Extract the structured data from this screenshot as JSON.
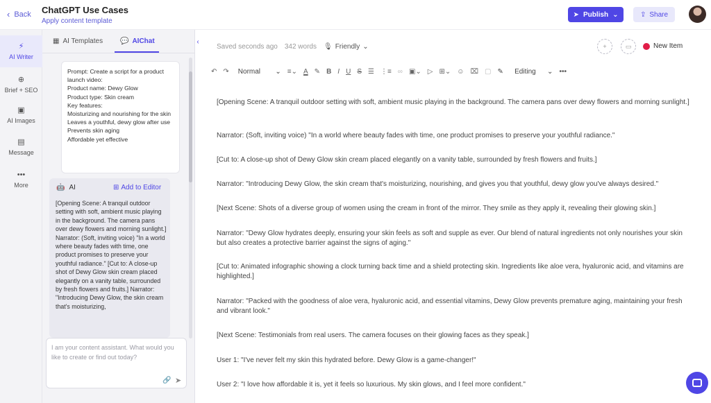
{
  "header": {
    "back_label": "Back",
    "title": "ChatGPT Use Cases",
    "subtitle": "Apply content template",
    "publish_label": "Publish",
    "share_label": "Share"
  },
  "rail": {
    "items": [
      {
        "label": "AI Writer",
        "icon": "lightning-icon"
      },
      {
        "label": "Brief + SEO",
        "icon": "target-icon"
      },
      {
        "label": "AI Images",
        "icon": "image-icon"
      },
      {
        "label": "Message",
        "icon": "chat-icon"
      },
      {
        "label": "More",
        "icon": "ellipsis-icon"
      }
    ]
  },
  "panel": {
    "tabs": [
      {
        "label": "AI Templates",
        "icon": "grid-icon"
      },
      {
        "label": "AIChat",
        "icon": "chat-bubbles-icon"
      }
    ],
    "prompt_lines": [
      "Prompt: Create a script for a product launch video:",
      "Product name: Dewy Glow",
      "Product type: Skin cream",
      "Key features:",
      "Moisturizing and nourishing for the skin",
      "Leaves a youthful, dewy glow after use",
      "Prevents skin aging",
      "Affordable yet effective"
    ],
    "ai_label": "AI",
    "add_to_editor": "Add to Editor",
    "ai_text": "[Opening Scene: A tranquil outdoor setting with soft, ambient music playing in the background. The camera pans over dewy flowers and morning sunlight.] Narrator: (Soft, inviting voice) \"In a world where beauty fades with time, one product promises to preserve your youthful radiance.\" [Cut to: A close-up shot of Dewy Glow skin cream placed elegantly on a vanity table, surrounded by fresh flowers and fruits.] Narrator: \"Introducing Dewy Glow, the skin cream that's moisturizing,",
    "input_placeholder": "I am your content assistant. What would you like to create or find out today?"
  },
  "editor": {
    "saved_status": "Saved seconds ago",
    "word_count": "342 words",
    "tone": "Friendly",
    "new_item_label": "New Item",
    "toolbar": {
      "style_select": "Normal",
      "mode_select": "Editing"
    },
    "paragraphs": [
      "[Opening Scene: A tranquil outdoor setting with soft, ambient music playing in the background. The camera pans over dewy flowers and morning sunlight.]",
      "Narrator: (Soft, inviting voice) \"In a world where beauty fades with time, one product promises to preserve your youthful radiance.\"",
      "[Cut to: A close-up shot of Dewy Glow skin cream placed elegantly on a vanity table, surrounded by fresh flowers and fruits.]",
      "Narrator: \"Introducing Dewy Glow, the skin cream that's moisturizing, nourishing, and gives you that youthful, dewy glow you've always desired.\"",
      "[Next Scene: Shots of a diverse group of women using the cream in front of the mirror. They smile as they apply it, revealing their glowing skin.]",
      "Narrator: \"Dewy Glow hydrates deeply, ensuring your skin feels as soft and supple as ever. Our blend of natural ingredients not only nourishes your skin but also creates a protective barrier against the signs of aging.\"",
      "[Cut to: Animated infographic showing a clock turning back time and a shield protecting skin. Ingredients like aloe vera, hyaluronic acid, and vitamins are highlighted.]",
      "Narrator: \"Packed with the goodness of aloe vera, hyaluronic acid, and essential vitamins, Dewy Glow prevents premature aging, maintaining your fresh and vibrant look.\"",
      "[Next Scene: Testimonials from real users. The camera focuses on their glowing faces as they speak.]",
      "User 1: \"I've never felt my skin this hydrated before. Dewy Glow is a game-changer!\"",
      "User 2: \"I love how affordable it is, yet it feels so luxurious. My skin glows, and I feel more confident.\""
    ]
  },
  "colors": {
    "accent": "#4f46e5",
    "new_item_dot": "#e11d48"
  }
}
